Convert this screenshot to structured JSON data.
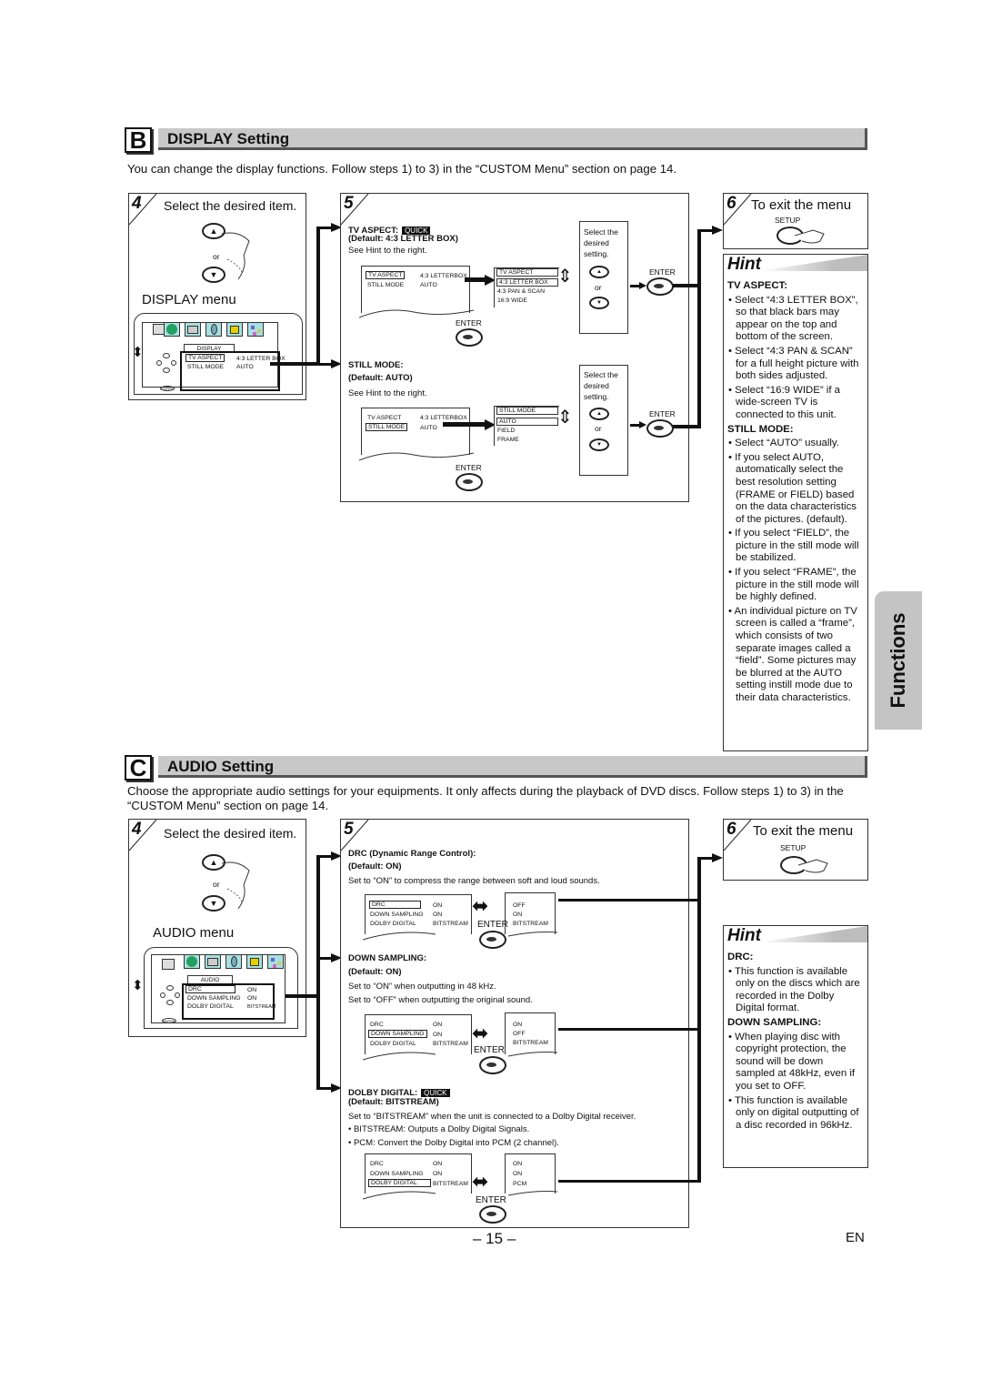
{
  "display_section": {
    "letter": "B",
    "title": "DISPLAY Setting",
    "intro": "You can change the display functions. Follow steps 1) to 3) in the “CUSTOM Menu” section on page 14.",
    "step4": {
      "number": "4",
      "title": "Select the desired item.",
      "or": "or",
      "up_icon": "up-arrow-button",
      "down_icon": "down-arrow-button",
      "menu_label": "DISPLAY menu",
      "screen": {
        "tab": "DISPLAY",
        "rows": [
          {
            "item": "TV ASPECT",
            "value": "4:3 LETTER BOX",
            "selected": true
          },
          {
            "item": "STILL MODE",
            "value": "AUTO",
            "selected": false
          }
        ],
        "enter": "ENTER"
      }
    },
    "step5": {
      "number": "5",
      "tv_aspect": {
        "heading": "TV ASPECT:",
        "quick": "QUICK",
        "default": "(Default: 4:3 LETTER BOX)",
        "note": "See Hint to the right.",
        "screen_rows": [
          {
            "item": "TV ASPECT",
            "value": "4:3 LETTERBOX"
          },
          {
            "item": "STILL MODE",
            "value": "AUTO"
          }
        ],
        "options_title": "TV ASPECT",
        "options": [
          "4:3 LETTER BOX",
          "4:3 PAN & SCAN",
          "16:9 WIDE"
        ],
        "select_hint": "Select the desired setting.",
        "or": "or",
        "enter": "ENTER"
      },
      "still_mode": {
        "heading": "STILL MODE:",
        "default": "(Default: AUTO)",
        "note": "See Hint to the right.",
        "screen_rows": [
          {
            "item": "TV ASPECT",
            "value": "4:3 LETTERBOX"
          },
          {
            "item": "STILL MODE",
            "value": "AUTO"
          }
        ],
        "options_title": "STILL MODE",
        "options": [
          "AUTO",
          "FIELD",
          "FRAME"
        ],
        "select_hint": "Select the desired setting.",
        "or": "or",
        "enter": "ENTER"
      }
    },
    "step6": {
      "number": "6",
      "title": "To exit the menu",
      "button": "SETUP"
    },
    "hint": {
      "title": "Hint",
      "groups": [
        {
          "heading": "TV ASPECT:",
          "bullets": [
            "Select “4:3 LETTER BOX”, so that black bars may appear on the top and bottom of the screen.",
            "Select “4:3 PAN & SCAN” for a full height picture with both sides adjusted.",
            "Select “16:9 WIDE” if a wide-screen TV is connected to this unit."
          ]
        },
        {
          "heading": "STILL MODE:",
          "bullets": [
            "Select “AUTO” usually.",
            "If you select AUTO, automatically select the best resolution setting (FRAME or FIELD) based on the data characteristics of the pictures. (default).",
            "If you select “FIELD”, the picture in the still mode will be stabilized.",
            "If you select “FRAME”, the picture in the still mode will be highly defined.",
            "An individual picture on TV screen is called a “frame”, which consists of two separate images called a “field”. Some pictures may be blurred at the AUTO setting instill mode due to their data characteristics."
          ]
        }
      ]
    }
  },
  "side_tab": "Functions",
  "audio_section": {
    "letter": "C",
    "title": "AUDIO Setting",
    "intro": "Choose the appropriate audio settings for your equipments. It only affects during the playback of DVD discs. Follow steps 1) to 3) in the “CUSTOM Menu” section on page 14.",
    "step4": {
      "number": "4",
      "title": "Select the desired item.",
      "or": "or",
      "menu_label": "AUDIO menu",
      "screen": {
        "tab": "AUDIO",
        "rows": [
          {
            "item": "DRC",
            "value": "ON",
            "selected": true
          },
          {
            "item": "DOWN SAMPLING",
            "value": "ON",
            "selected": false
          },
          {
            "item": "DOLBY DIGITAL",
            "value": "BITSTREAM",
            "selected": false
          }
        ],
        "enter": "ENTER"
      }
    },
    "step5": {
      "number": "5",
      "drc": {
        "heading": "DRC (Dynamic Range Control):",
        "default": "(Default: ON)",
        "notes": [
          "Set to “ON” to compress the range between soft and loud sounds."
        ],
        "rows": [
          {
            "item": "DRC",
            "from": "ON",
            "to": "OFF"
          },
          {
            "item": "DOWN SAMPLING",
            "from": "ON",
            "to": "ON"
          },
          {
            "item": "DOLBY DIGITAL",
            "from": "BITSTREAM",
            "to": "BITSTREAM"
          }
        ],
        "enter": "ENTER"
      },
      "down_sampling": {
        "heading": "DOWN SAMPLING:",
        "default": "(Default: ON)",
        "notes": [
          "Set to “ON” when outputting in 48 kHz.",
          "Set to “OFF” when outputting the original sound."
        ],
        "rows": [
          {
            "item": "DRC",
            "from": "ON",
            "to": "ON"
          },
          {
            "item": "DOWN SAMPLING",
            "from": "ON",
            "to": "OFF"
          },
          {
            "item": "DOLBY DIGITAL",
            "from": "BITSTREAM",
            "to": "BITSTREAM"
          }
        ],
        "enter": "ENTER"
      },
      "dolby_digital": {
        "heading": "DOLBY DIGITAL:",
        "quick": "QUICK",
        "default": "(Default: BITSTREAM)",
        "notes": [
          "Set to “BITSTREAM” when the unit is connected to a Dolby Digital receiver.",
          "• BITSTREAM: Outputs a Dolby Digital Signals.",
          "• PCM: Convert the Dolby Digital into PCM (2 channel)."
        ],
        "rows": [
          {
            "item": "DRC",
            "from": "ON",
            "to": "ON"
          },
          {
            "item": "DOWN SAMPLING",
            "from": "ON",
            "to": "ON"
          },
          {
            "item": "DOLBY DIGITAL",
            "from": "BITSTREAM",
            "to": "PCM"
          }
        ],
        "enter": "ENTER"
      }
    },
    "step6": {
      "number": "6",
      "title": "To exit the menu",
      "button": "SETUP"
    },
    "hint": {
      "title": "Hint",
      "groups": [
        {
          "heading": "DRC:",
          "bullets": [
            "This function is available only on the discs which are recorded in the Dolby Digital format."
          ]
        },
        {
          "heading": "DOWN SAMPLING:",
          "bullets": [
            "When playing disc with copyright protection, the sound will be down sampled at 48kHz, even if you set to OFF.",
            "This function is available only on digital outputting of a disc recorded in 96kHz."
          ]
        }
      ]
    }
  },
  "footer": {
    "page": "– 15 –",
    "lang": "EN"
  }
}
